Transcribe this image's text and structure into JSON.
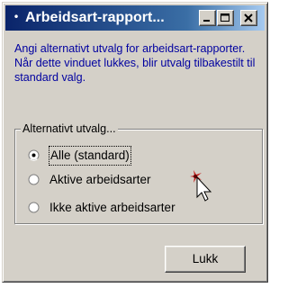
{
  "window": {
    "title": "Arbeidsart-rapport...",
    "system_icon": "bullet-icon",
    "controls": [
      "minimize-icon",
      "maximize-icon",
      "close-icon"
    ]
  },
  "description": "Angi alternativt utvalg for arbeidsart-rapporter.  Når dette vinduet lukkes, blir utvalg tilbakestilt til standard valg.",
  "group": {
    "legend": "Alternativt utvalg...",
    "options": [
      {
        "label": "Alle (standard)",
        "selected": true,
        "focused": true
      },
      {
        "label": "Aktive arbeidsarter",
        "selected": false,
        "focused": false
      },
      {
        "label": "Ikke aktive arbeidsarter",
        "selected": false,
        "focused": false
      }
    ]
  },
  "buttons": {
    "close": "Lukk"
  },
  "colors": {
    "title_gradient_start": "#0a246a",
    "title_gradient_end": "#a6caf0",
    "description_text": "#0000a0",
    "dialog_face": "#d4d0c8",
    "click_highlight": "#c00000"
  }
}
